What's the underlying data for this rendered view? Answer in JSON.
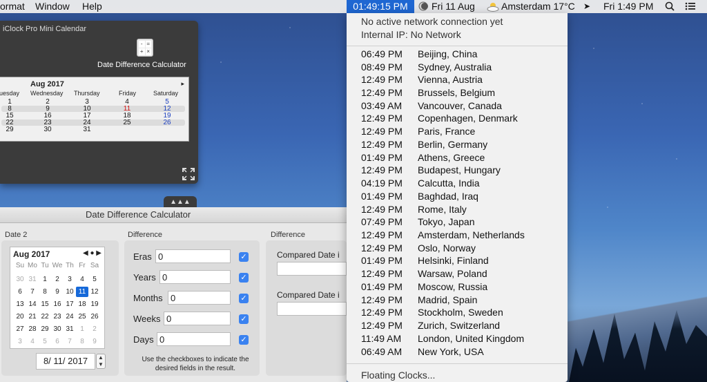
{
  "menubar": {
    "items": [
      "ormat",
      "Window",
      "Help"
    ],
    "clock_time": "01:49:15 PM",
    "date": "Fri 11 Aug",
    "weather": "Amsterdam 17°C",
    "system_time": "Fri 1:49 PM"
  },
  "iclock": {
    "title": "iClock Pro Mini Calendar",
    "ddc_label": "Date Difference Calculator",
    "calendar": {
      "month": "Aug 2017",
      "next": "▸",
      "weekdays": [
        "uesday",
        "Wednesday",
        "Thursday",
        "Friday",
        "Saturday"
      ],
      "rows": [
        [
          "1",
          "2",
          "3",
          "4",
          "5"
        ],
        [
          "8",
          "9",
          "10",
          "11",
          "12"
        ],
        [
          "15",
          "16",
          "17",
          "18",
          "19"
        ],
        [
          "22",
          "23",
          "24",
          "25",
          "26"
        ],
        [
          "29",
          "30",
          "31",
          "",
          ""
        ]
      ]
    }
  },
  "ddc": {
    "title": "Date Difference Calculator",
    "date2_label": "Date 2",
    "difference_label": "Difference",
    "difference2_label": "Difference",
    "picker": {
      "month": "Aug 2017",
      "nav": "◀ ● ▶",
      "headers": [
        "Su",
        "Mo",
        "Tu",
        "We",
        "Th",
        "Fr",
        "Sa"
      ],
      "weeks": [
        [
          "30",
          "31",
          "1",
          "2",
          "3",
          "4",
          "5"
        ],
        [
          "6",
          "7",
          "8",
          "9",
          "10",
          "11",
          "12"
        ],
        [
          "13",
          "14",
          "15",
          "16",
          "17",
          "18",
          "19"
        ],
        [
          "20",
          "21",
          "22",
          "23",
          "24",
          "25",
          "26"
        ],
        [
          "27",
          "28",
          "29",
          "30",
          "31",
          "1",
          "2"
        ],
        [
          "3",
          "4",
          "5",
          "6",
          "7",
          "8",
          "9"
        ]
      ],
      "selected": "11"
    },
    "date_value": "8/ 11/ 2017",
    "fields": [
      {
        "label": "Eras",
        "value": "0"
      },
      {
        "label": "Years",
        "value": "0"
      },
      {
        "label": "Months",
        "value": "0"
      },
      {
        "label": "Weeks",
        "value": "0"
      },
      {
        "label": "Days",
        "value": "0"
      }
    ],
    "hint": "Use the checkboxes to indicate the desired fields in the result.",
    "compared_label_1": "Compared Date i",
    "compared_label_2": "Compared Date i"
  },
  "dropdown": {
    "network_status": "No active network connection yet",
    "internal_ip": "Internal IP: No Network",
    "cities": [
      {
        "time": "06:49 PM",
        "name": "Beijing, China"
      },
      {
        "time": "08:49 PM",
        "name": "Sydney, Australia"
      },
      {
        "time": "12:49 PM",
        "name": "Vienna, Austria"
      },
      {
        "time": "12:49 PM",
        "name": "Brussels, Belgium"
      },
      {
        "time": "03:49 AM",
        "name": "Vancouver, Canada"
      },
      {
        "time": "12:49 PM",
        "name": "Copenhagen, Denmark"
      },
      {
        "time": "12:49 PM",
        "name": "Paris, France"
      },
      {
        "time": "12:49 PM",
        "name": "Berlin, Germany"
      },
      {
        "time": "01:49 PM",
        "name": "Athens, Greece"
      },
      {
        "time": "12:49 PM",
        "name": "Budapest, Hungary"
      },
      {
        "time": "04:19 PM",
        "name": "Calcutta, India"
      },
      {
        "time": "01:49 PM",
        "name": "Baghdad, Iraq"
      },
      {
        "time": "12:49 PM",
        "name": "Rome, Italy"
      },
      {
        "time": "07:49 PM",
        "name": "Tokyo, Japan"
      },
      {
        "time": "12:49 PM",
        "name": "Amsterdam, Netherlands"
      },
      {
        "time": "12:49 PM",
        "name": "Oslo, Norway"
      },
      {
        "time": "01:49 PM",
        "name": "Helsinki, Finland"
      },
      {
        "time": "12:49 PM",
        "name": "Warsaw, Poland"
      },
      {
        "time": "01:49 PM",
        "name": "Moscow, Russia"
      },
      {
        "time": "12:49 PM",
        "name": "Madrid, Spain"
      },
      {
        "time": "12:49 PM",
        "name": "Stockholm, Sweden"
      },
      {
        "time": "12:49 PM",
        "name": "Zurich, Switzerland"
      },
      {
        "time": "11:49 AM",
        "name": "London, United Kingdom"
      },
      {
        "time": "06:49 AM",
        "name": "New York, USA"
      }
    ],
    "floating_clocks": "Floating Clocks..."
  },
  "icons": {
    "moon": "moon-icon",
    "weather": "partly-cloudy-icon",
    "cursor": "arrow-cursor-icon",
    "search": "search-icon",
    "list": "list-icon",
    "calculator": "calculator-icon",
    "expand": "expand-icon"
  },
  "colors": {
    "accent": "#1f67d2",
    "checkbox": "#3a82f0",
    "red_day": "#d01010",
    "blue_day": "#1a3ebf"
  }
}
